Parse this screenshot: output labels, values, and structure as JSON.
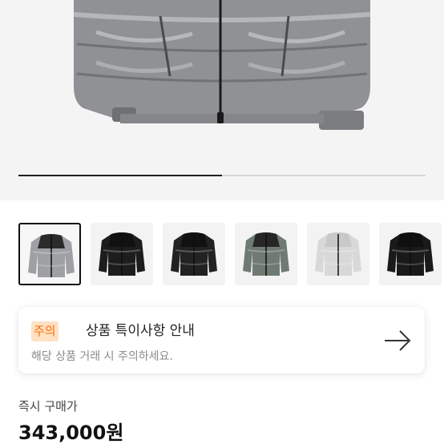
{
  "product": {
    "gallery_progress": 0.5,
    "thumbnails": [
      {
        "name": "grey-jacket-thumbnail",
        "colors": {
          "body": "#9ea0a4",
          "trim": "#2b2b2b"
        }
      },
      {
        "name": "black-jacket-thumbnail",
        "colors": {
          "body": "#1d1d1d",
          "trim": "#111111"
        }
      },
      {
        "name": "black-jacket-thumbnail",
        "colors": {
          "body": "#222222",
          "trim": "#111111"
        }
      },
      {
        "name": "green-jacket-thumbnail",
        "colors": {
          "body": "#6e7a72",
          "trim": "#262626"
        }
      },
      {
        "name": "white-camo-jacket-thumbnail",
        "colors": {
          "body": "#d8d8d8",
          "trim": "#c8c8c8"
        }
      },
      {
        "name": "black-jacket-thumbnail",
        "colors": {
          "body": "#1a1a1a",
          "trim": "#101010"
        }
      }
    ],
    "selected_thumbnail": 0
  },
  "notice": {
    "badge": "주의",
    "title": "상품 특이사항 안내",
    "subtitle": "해당 상품 거래 시 주의하세요."
  },
  "price": {
    "label": "즉시 구매가",
    "value": "343,000원"
  },
  "colors": {
    "accent": "#ff6a00",
    "badge_bg": "#ffe1c4",
    "jacket_main": "#8d8f93"
  }
}
